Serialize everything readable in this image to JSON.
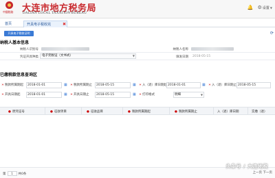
{
  "header": {
    "seal_text": "中國稅務",
    "brand_cn": "大连市地方税务局",
    "brand_en": "DALIAN LOCAL TAXATION BUREAU",
    "settings_label": "设置"
  },
  "tabs": [
    {
      "label": "首页"
    },
    {
      "label": "开具电子税收完"
    }
  ],
  "toolbar": {
    "primary_label": "开具电子税收证明"
  },
  "sections": {
    "basic_info": "纳税人基本信息",
    "query": "已缴税款信息查询区"
  },
  "basic_info": {
    "taxpayer_id_label": "纳税人识别号",
    "taxpayer_name_label": "纳税人名称",
    "voucher_type_label": "凭证开具种类",
    "voucher_type_value": "电子完税证（文书式）",
    "fill_date_label": "填发日期",
    "fill_date_value": "2018-05-15"
  },
  "query": {
    "tax_period_start_label": "税款所属期起",
    "tax_period_start_value": "2018-01-01",
    "tax_period_end_label": "税款所属期止",
    "tax_period_end_value": "2018-05-15",
    "stock_start_label": "入（退）库日期起",
    "stock_start_value": "2018-01-01",
    "stock_end_label": "入（退）库日期止",
    "stock_end_value": "2018-05-15",
    "issue_start_label": "开具日期起",
    "issue_start_value": "2018-01-01",
    "issue_end_label": "开具日期止",
    "issue_end_value": "2018-05-15",
    "print_format_label": "打印格式",
    "print_format_value": "明细"
  },
  "table": {
    "columns": [
      "原凭证号",
      "征收项目",
      "征收品目",
      "税款所属期起",
      "税款所属期止",
      "入（退）库日期",
      "实缴（退）"
    ]
  },
  "footer": {
    "page_prefix": "第",
    "page_value": "1",
    "page_suffix": "共0条",
    "pager_right": "上一页  下一页"
  },
  "watermark": "头条号 / 大连地税"
}
